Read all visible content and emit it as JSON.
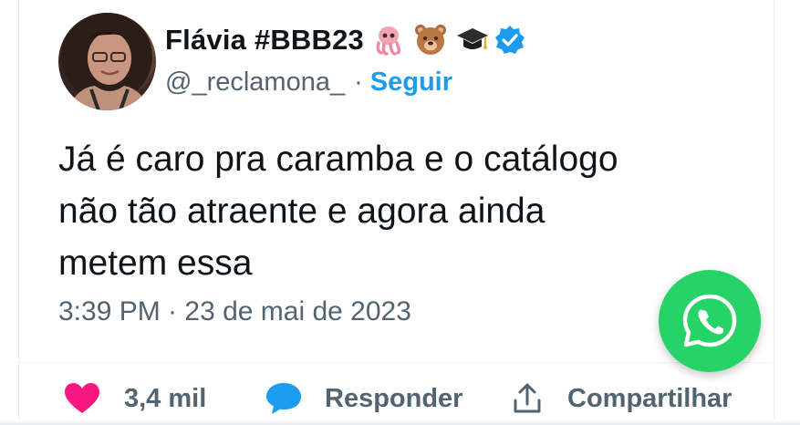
{
  "author": {
    "display_name": "Flávia #BBB23",
    "handle": "@_reclamona_",
    "separator": "·",
    "follow_label": "Seguir",
    "name_emojis": [
      "octopus-icon",
      "bear-face-icon",
      "graduation-cap-icon"
    ],
    "verified": true
  },
  "tweet": {
    "lines": [
      "Já é caro pra caramba e o catálogo",
      "não tão atraente e agora ainda",
      "metem essa"
    ],
    "timestamp": "3:39 PM · 23 de mai de 2023"
  },
  "actions": {
    "like_count": "3,4 mil",
    "reply_label": "Responder",
    "share_label": "Compartilhar"
  },
  "colors": {
    "accent": "#1d9bf0",
    "like": "#f91880",
    "whatsapp": "#25d366",
    "text": "#0f1419",
    "secondary": "#536471"
  },
  "floating_button": "whatsapp-icon"
}
